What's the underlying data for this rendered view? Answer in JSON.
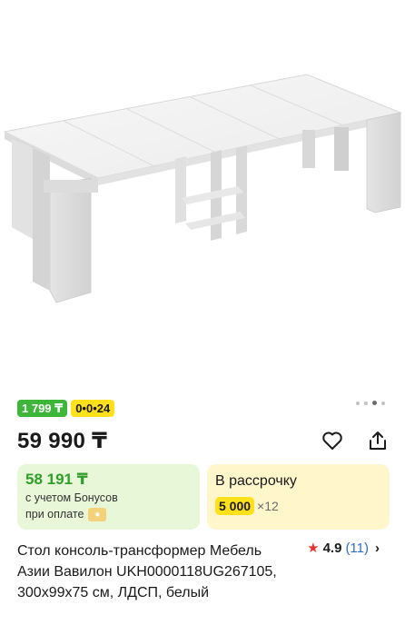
{
  "product": {
    "image_alt": "white extendable console table",
    "gallery_dots": 4,
    "gallery_active": 3,
    "title": "Стол консоль-трансформер Мебель Азии Вавилон UKH0000118UG267105, 300x99x75 см, ЛДСП, белый"
  },
  "badges": {
    "monthly": "1 799 ₸",
    "term": "0•0•24"
  },
  "price": {
    "main": "59 990 ₸"
  },
  "bonus_card": {
    "price": "58 191 ₸",
    "note_line1": "с учетом Бонусов",
    "note_line2": "при оплате",
    "icon": "bonus-coin-icon"
  },
  "installment_card": {
    "title": "В рассрочку",
    "amount": "5 000",
    "multiplier": "×12"
  },
  "rating": {
    "value": "4.9",
    "reviews": "(11)"
  },
  "colors": {
    "green": "#3eb63a",
    "yellow": "#ffe11b",
    "star": "#e5322d",
    "link": "#2f6fc4"
  }
}
